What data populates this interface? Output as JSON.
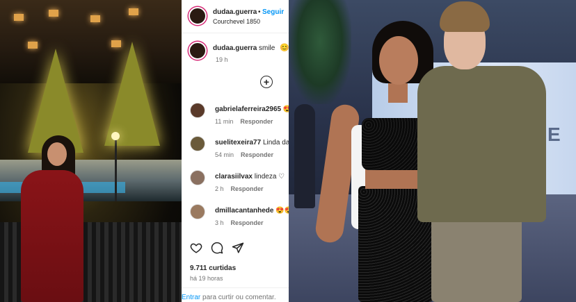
{
  "post": {
    "username": "dudaa.guerra",
    "dot": "•",
    "follow_label": "Seguir",
    "location": "Courchevel 1850"
  },
  "caption": {
    "username": "dudaa.guerra",
    "text": "smile",
    "emoji": "😊",
    "time": "19 h"
  },
  "add_comment_symbol": "+",
  "comments": [
    {
      "username": "gabrielaferreira2965",
      "text": "😍",
      "time": "11 min",
      "reply_label": "Responder"
    },
    {
      "username": "suelitexeira77",
      "text": "Linda da",
      "time": "54 min",
      "reply_label": "Responder"
    },
    {
      "username": "clarasiilvax",
      "text": "lindeza ♡",
      "time": "2 h",
      "reply_label": "Responder"
    },
    {
      "username": "dmillacantanhede",
      "text": "😍😍",
      "time": "3 h",
      "reply_label": "Responder"
    }
  ],
  "likes": "9.711 curtidas",
  "posted_ago": "há 19 horas",
  "footer": {
    "login_link": "Entrar",
    "text": " para curtir ou comentar."
  },
  "right_photo": {
    "backdrop_text": "E"
  }
}
